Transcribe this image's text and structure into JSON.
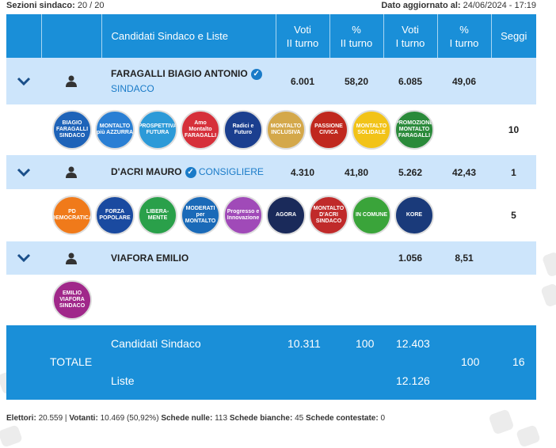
{
  "header": {
    "sezioni_label": "Sezioni sindaco:",
    "sezioni_value": "20 / 20",
    "updated_label": "Dato aggiornato al:",
    "updated_value": "24/06/2024 - 17:19"
  },
  "columns": {
    "candidati": "Candidati Sindaco e Liste",
    "voti2_a": "Voti",
    "voti2_b": "II turno",
    "pct2_a": "%",
    "pct2_b": "II turno",
    "voti1_a": "Voti",
    "voti1_b": "I turno",
    "pct1_a": "%",
    "pct1_b": "I turno",
    "seggi": "Seggi"
  },
  "candidates": [
    {
      "name": "FARAGALLI BIAGIO ANTONIO",
      "role": "SINDACO",
      "voti2": "6.001",
      "pct2": "58,20",
      "voti1": "6.085",
      "pct1": "49,06",
      "seggi": "",
      "lists_seggi": "10",
      "lists": [
        {
          "label": "BIAGIO FARAGALLI SINDACO",
          "color": "#1e63b8"
        },
        {
          "label": "MONTALTO più AZZURRA",
          "color": "#2a7fd4"
        },
        {
          "label": "PROSPETTIVA FUTURA",
          "color": "#2c9ad8"
        },
        {
          "label": "Amo Montalto FARAGALLI",
          "color": "#d6303a"
        },
        {
          "label": "Radici e Futuro",
          "color": "#1b3f8f"
        },
        {
          "label": "MONTALTO INCLUSIVA",
          "color": "#d4a84a"
        },
        {
          "label": "PASSIONE CIVICA",
          "color": "#c0281e"
        },
        {
          "label": "MONTALTO SOLIDALE",
          "color": "#f2c318"
        },
        {
          "label": "PROMOZIONE MONTALTO FARAGALLI",
          "color": "#2a8a3a"
        }
      ]
    },
    {
      "name": "D'ACRI MAURO",
      "role": "CONSIGLIERE",
      "voti2": "4.310",
      "pct2": "41,80",
      "voti1": "5.262",
      "pct1": "42,43",
      "seggi": "1",
      "lists_seggi": "5",
      "lists": [
        {
          "label": "PD DEMOCRATICA",
          "color": "#f07a1a"
        },
        {
          "label": "FORZA POPOLARE",
          "color": "#1a4aa0"
        },
        {
          "label": "LIBERA-MENTE",
          "color": "#2aa04a"
        },
        {
          "label": "MODERATI per MONTALTO",
          "color": "#1a6ab8"
        },
        {
          "label": "Progresso e Innovazione",
          "color": "#a04ab8"
        },
        {
          "label": "AGORA",
          "color": "#1a2a5a"
        },
        {
          "label": "MONTALTO D'ACRI SINDACO",
          "color": "#c02a2a"
        },
        {
          "label": "IN COMUNE",
          "color": "#3aa43a"
        },
        {
          "label": "KORE",
          "color": "#1a3a7a"
        }
      ]
    },
    {
      "name": "VIAFORA EMILIO",
      "role": "",
      "voti2": "",
      "pct2": "",
      "voti1": "1.056",
      "pct1": "8,51",
      "seggi": "",
      "lists_seggi": "",
      "lists": [
        {
          "label": "EMILIO VIAFORA SINDACO",
          "color": "#a0288a"
        }
      ]
    }
  ],
  "totale": {
    "label": "TOTALE",
    "candidati_label": "Candidati Sindaco",
    "liste_label": "Liste",
    "cand_voti2": "10.311",
    "cand_pct2": "100",
    "cand_voti1": "12.403",
    "liste_voti1": "12.126",
    "pct1": "100",
    "seggi": "16"
  },
  "footer": {
    "elettori_label": "Elettori:",
    "elettori": "20.559",
    "votanti_label": "Votanti:",
    "votanti": "10.469 (50,92%)",
    "nulle_label": "Schede nulle:",
    "nulle": "113",
    "bianche_label": "Schede bianche:",
    "bianche": "45",
    "contestate_label": "Schede contestate:",
    "contestate": "0"
  }
}
